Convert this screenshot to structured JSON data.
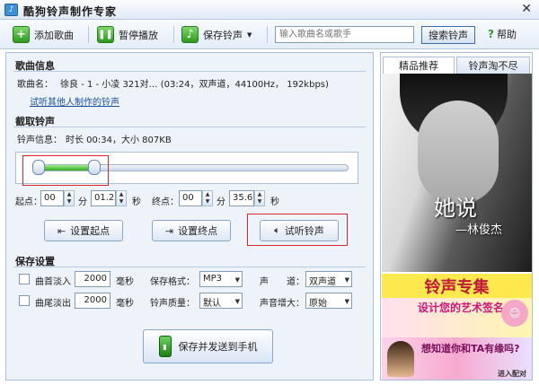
{
  "title": "酷狗铃声制作专家",
  "toolbar": {
    "add_song": "添加歌曲",
    "pause": "暂停播放",
    "save_ringtone": "保存铃声",
    "search_placeholder": "输入歌曲名或歌手",
    "search_button": "搜索铃声",
    "help": "帮助"
  },
  "song_info": {
    "section_title": "歌曲信息",
    "label": "歌曲名：",
    "value": "徐良 - 1 - 小凌 321对… (03:24，双声道，44100Hz， 192kbps)",
    "try_link": "试听其他人制作的铃声"
  },
  "clip": {
    "section_title": "截取铃声",
    "info_label": "铃声信息：",
    "info_value": "时长 00:34，大小 807KB",
    "progress_fraction": 0.18,
    "start_label": "起点：",
    "start_min": "00",
    "start_sec": "01.2",
    "min_unit": "分",
    "sec_unit": "秒",
    "end_label": "终点：",
    "end_min": "00",
    "end_sec": "35.6",
    "set_start": "设置起点",
    "set_end": "设置终点",
    "preview": "试听铃声"
  },
  "save_settings": {
    "section_title": "保存设置",
    "fade_in_label": "曲首淡入",
    "fade_in_value": "2000",
    "fade_out_label": "曲尾淡出",
    "fade_out_value": "2000",
    "ms_unit": "毫秒",
    "format_label": "保存格式：",
    "format_value": "MP3",
    "channel_label": "声　　道：",
    "channel_value": "双声道",
    "quality_label": "铃声质量：",
    "quality_value": "默认",
    "volume_label": "声音增大：",
    "volume_value": "原始",
    "save_send": "保存并发送到手机"
  },
  "right_panel": {
    "tab_featured": "精品推荐",
    "tab_market": "铃声淘不尽",
    "photo_text": "她说",
    "photo_subtext": "—林俊杰",
    "ad1": "铃声专集",
    "ad2": "设计您的艺术签名",
    "ad3": "想知道你和TA有缘吗?",
    "ad3_small": "进入配对"
  }
}
